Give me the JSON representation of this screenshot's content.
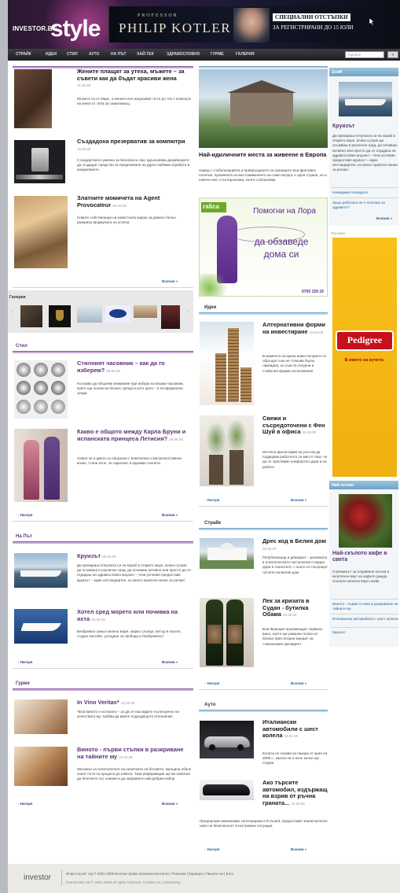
{
  "header": {
    "logo": "INVESTOR.BG",
    "logo_style": "style",
    "banner": {
      "professor": "PROFESSOR",
      "name": "PHILIP KOTLER",
      "promo_line1": "СПЕЦИАЛНИ ОТСТЪПКИ",
      "promo_line2": "ЗА РЕГИСТРИРАНИ ДО 15 ЮЛИ"
    }
  },
  "nav": {
    "items": [
      "СТРАЙК",
      "ИДЕИ",
      "СТИЛ",
      "АУТО",
      "НА ПЪТ",
      "ХАЙ-ТЕК",
      "ЗДРАВОСЛОВНО",
      "ГУРМЕ",
      "ГАЛЕРИЯ"
    ],
    "search_placeholder": "търсене",
    "search_button": "»"
  },
  "left": {
    "articles": [
      {
        "title": "Жените плащат за утеха, мъжете – за съвети как да бъдат красиви жена",
        "date": "11.06.09",
        "text": "Мъжете са от Марс, а жените все изкушават пътя до тях с помощта на книги от типа за самопомощ"
      },
      {
        "title": "Създадоха презерватив за компютри",
        "date": "10.06.09",
        "text": "Стандартната гумичка за безопасен секс вдъхновява дизайнерите да създадат средства за предпазване на други любими атрибути в ежедневието"
      },
      {
        "title": "Златните момичета на Agent Provocateur",
        "date": "09.06.09",
        "text": "Новите собственици на известната марка за дамско бельо разкриха формулата на успеха"
      }
    ],
    "more": "Всички »",
    "gallery_label": "Галерия",
    "stil": {
      "heading": "Стил",
      "articles": [
        {
          "title": "Стилният часовник – как да го изберем?",
          "date": "09.06.09",
          "text": "На какво да обърнем внимание при избора на мъжки часовник, който ще носим на бизнес среща и кото цело – в по-формална среда"
        },
        {
          "title": "Какво е общото между Карла Бруни и испанската принцеса Летисия?",
          "date": "05.06.09",
          "text": "Освен че и двете са свързани с влиятелни и високопоставени мъже, стана ясно, че харесват и еднакви тоалети"
        }
      ],
      "top": "Нагоре",
      "more": "Всички »"
    },
    "naput": {
      "heading": "На Път",
      "articles": [
        {
          "title": "Круизът",
          "date": "08.06.09",
          "text": "Да прекараш отпуската си на кораб в открито море, всяка сутрин да осъмваш в различен град, да почиваш активно или просто да се отдадеш на здравословен мързел – тези условия предоставя круизът – един нестандартен, но много приятен начин за релакс"
        },
        {
          "title": "Хотел сред морето или почивка на яхта",
          "date": "05.06.09",
          "text": "Безбрежно синьо-зелено море, жарко слънце, вятър в косите, студен коктейл, усещане за свобода и безбрежност"
        }
      ],
      "top": "Нагоре",
      "more": "Всички »"
    },
    "gurme": {
      "heading": "Гурме",
      "articles": [
        {
          "title": "In Vino Veritas*",
          "date": "24.03.09",
          "text": "*Във виното е истината – за да се насладите пълноценно на качествата му, трябва да имате подходящото отношение"
        },
        {
          "title": "Виното - първи стъпки в разкриване на тайните му",
          "date": "20.03.09",
          "text": "Мнозина са почитателите на напитката на боговете, малцина обаче знаят пътя на процеса до избата. Тази информация ще ви помогне да блеснете със знания и да направите най-добрия избор"
        }
      ],
      "top": "Нагоре",
      "more": "Всички »"
    }
  },
  "middle": {
    "feature": {
      "title": "Най-идиличните места за живеене в Европа",
      "text": "Наред с глобализацията и превръщането на границите във фиктивно понятие, промяната на местоживеенето на само въпрос е една страна, но и повече нея, е алтернатива, която съблазнява"
    },
    "ad": {
      "brand": "ralica",
      "line1": "Помогни на Лора",
      "line2": "да обзаведе",
      "line3": "дома си",
      "phone": "0700 159 19"
    },
    "idei": {
      "heading": "Идеи",
      "articles": [
        {
          "title": "Алтернативни форми на инвестиране",
          "date": "16.03.09",
          "text": "В момента на криза инвеститорите се обръщат към не толкова бързо ликвидни, но към по-сигурни и стабилни форми на вложения"
        },
        {
          "title": "Свежи и съсредоточени с Фен Шуй в офиса",
          "date": "26.02.09",
          "text": "Източна философия ни учи как да подредим работното си място така, че да се чувстваме комфортно дори и на работа"
        }
      ],
      "top": "Нагоре",
      "more": "Всички »"
    },
    "straik": {
      "heading": "Страйк",
      "articles": [
        {
          "title": "Дрес код в Белия дом",
          "date": "26.05.09",
          "text": "Републиканци и демократ – разликата в политическите настроения е видна дори в тоалетите, с които се посрещат гостите на Белия дом"
        },
        {
          "title": "Лек за кризата в Судан - бутилка Обама",
          "date": "20.05.09",
          "text": "Във Франция произвеждат червено вино, което ще разкрие пъпка си близък през втория мандат на тъмнокожия президент"
        }
      ],
      "top": "Нагоре",
      "more": "Всички »"
    },
    "auto": {
      "heading": "Ауто",
      "articles": [
        {
          "title": "Италиански автомобили с шест колела",
          "date": "02.06.09",
          "text": "Колата се очаква на пазара от края на 2009 г., засега не е ясно колко ще струва"
        },
        {
          "title": "Ако търсите автомобил, издържащ на взрив от ръчна граната...",
          "date": "22.03.09",
          "text": "Предлагаме механизми, интегрирани в E-Guard, предоставят изключително ниво на безопасност в екстремни ситуации"
        }
      ],
      "top": "Нагоре",
      "more": "Всички »"
    }
  },
  "right": {
    "zoom": {
      "heading": "ZooM",
      "title": "Круизът",
      "text": "Да прекараш отпуската си на кораб в открито море, всяка сутрин да осъмваш в различен град, да почиваш активно или просто да се отдадеш на здравословен мързел – тези условия предоставя круизът – един нестандартен, но много приятен начин за релакс",
      "links": [
        "Невидими псеводоги",
        "Защо работата не е полезна за здравето?"
      ],
      "more": "Всички »"
    },
    "ad": {
      "label": "Реклама",
      "brand": "Pedigree",
      "tagline": "В името на кучето."
    },
    "popular": {
      "heading": "Най-четени",
      "title": "Най-скъпото кафе в света",
      "text": "Стремежът за откриване на нов и екзотичен вкус на кафето ражда скъпата напитка Кopi Luwak",
      "links": [
        "Виното - първи стъпки в разкриване на тайните му",
        "Италиански автомобили с шест колела",
        "Круизът"
      ]
    }
  },
  "footer": {
    "logo": "investor",
    "line1": "Инвестор.БГ АД © 2001-2009 Всички права запазени Контакти | Реклама | Кариери | Пишете ни | Блог",
    "line2": "Investor.BG AD © 2001-2009 All rights reserved. Contact Us | Advertising"
  }
}
